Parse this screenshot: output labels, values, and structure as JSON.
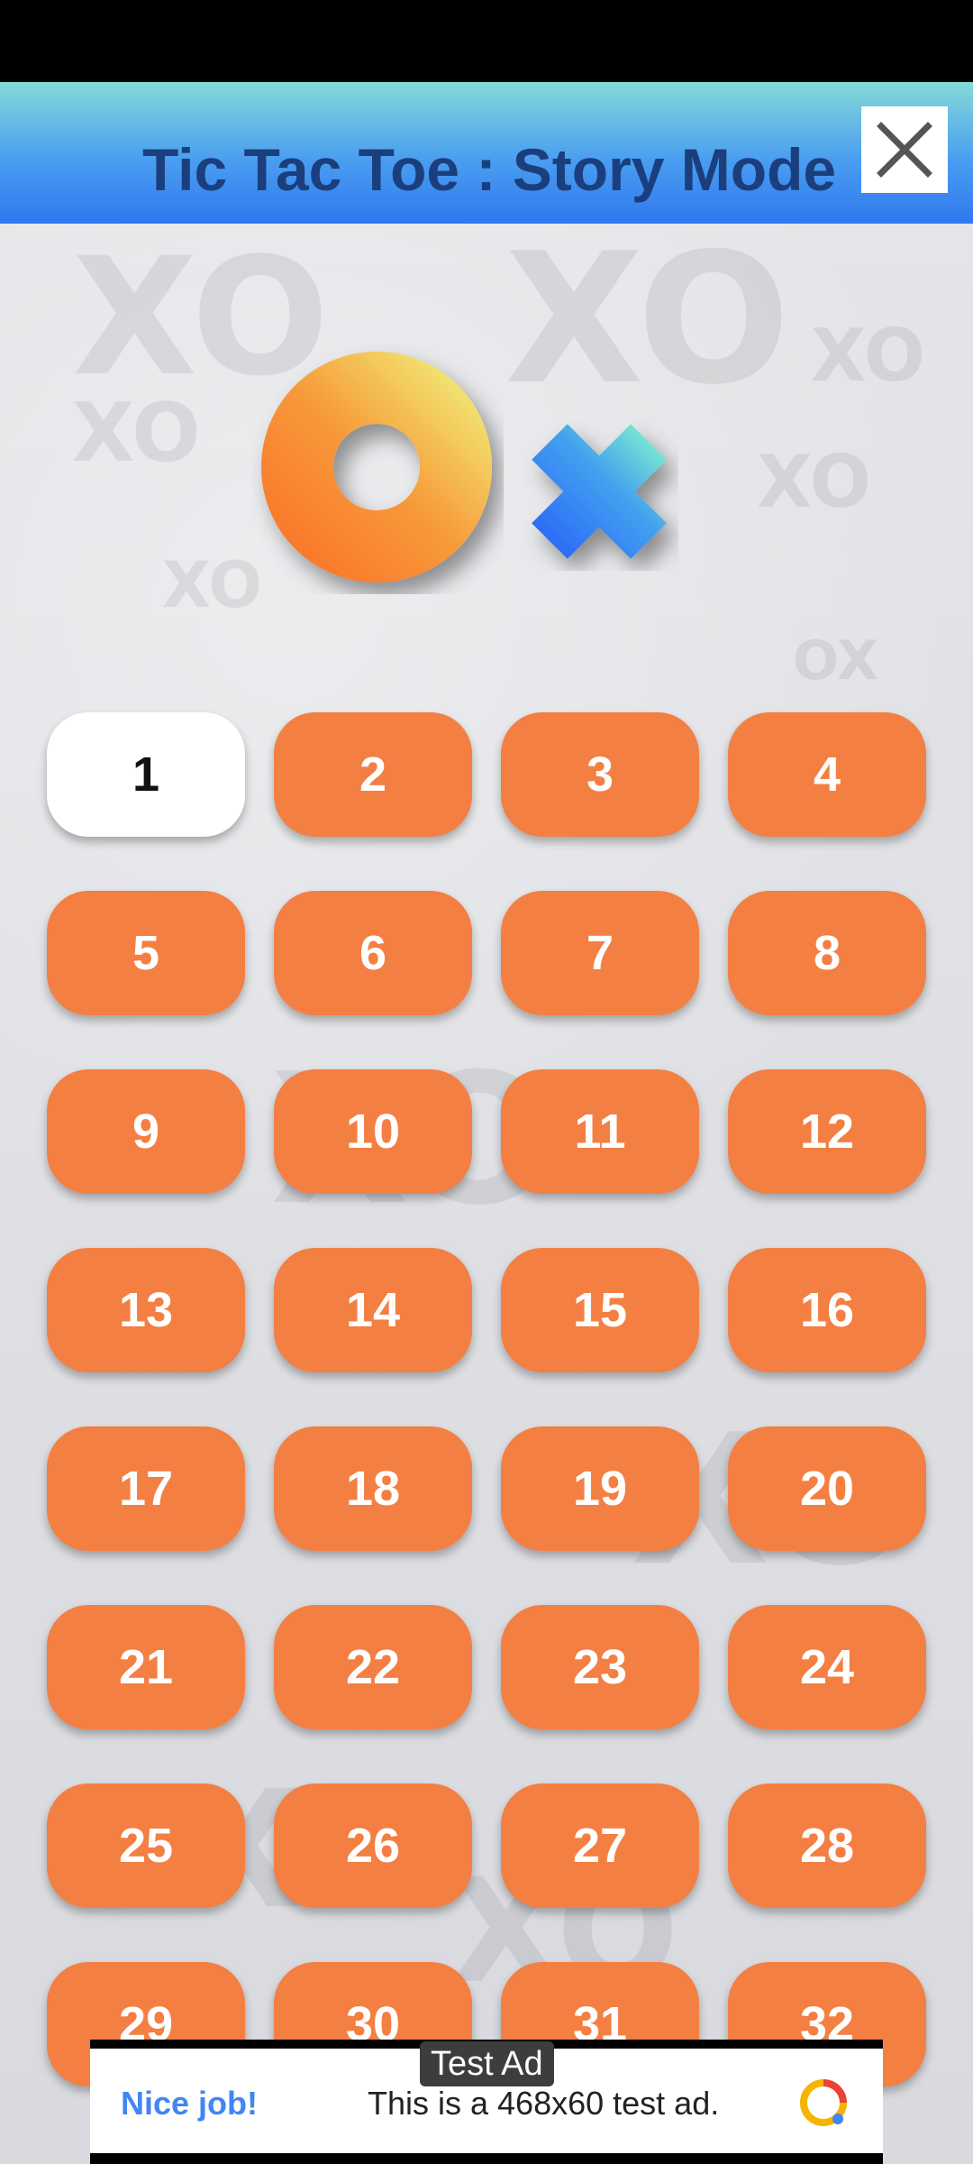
{
  "header": {
    "title": "Tic Tac Toe : Story Mode",
    "close_icon": "close-icon"
  },
  "logo": {
    "icon": "o-x-logo"
  },
  "levels": [
    "1",
    "2",
    "3",
    "4",
    "5",
    "6",
    "7",
    "8",
    "9",
    "10",
    "11",
    "12",
    "13",
    "14",
    "15",
    "16",
    "17",
    "18",
    "19",
    "20",
    "21",
    "22",
    "23",
    "24",
    "25",
    "26",
    "27",
    "28",
    "29",
    "30",
    "31",
    "32"
  ],
  "current_level": "1",
  "ad": {
    "label": "Test Ad",
    "headline": "Nice job!",
    "text": "This is a 468x60 test ad.",
    "icon": "adchoices-icon"
  },
  "colors": {
    "level_button": "#f47f42",
    "level_button_current": "#ffffff",
    "title": "#1b3f7d",
    "header_top": "#84dad7",
    "header_bottom": "#2f78ef"
  }
}
